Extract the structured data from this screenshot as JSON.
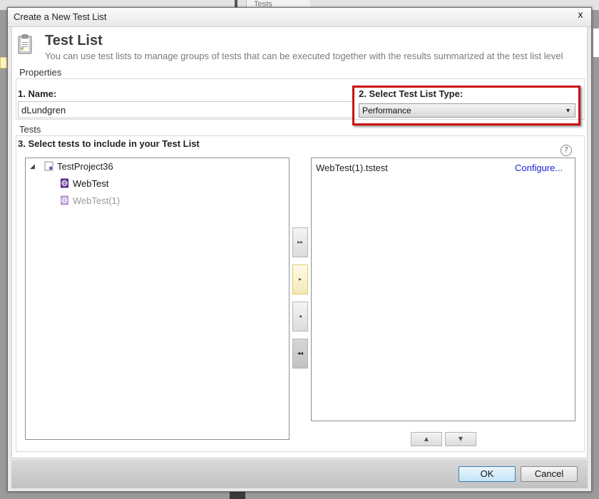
{
  "background": {
    "tab_label": "Tests"
  },
  "dialog": {
    "title": "Create a New Test List",
    "close_glyph": "x"
  },
  "header": {
    "icon": "clipboard-icon",
    "title": "Test List",
    "subtitle": "You can use test lists to manage groups of tests that can be executed together with the results summarized at the test list level"
  },
  "properties": {
    "group_label": "Properties",
    "name_label": "1. Name:",
    "name_value": "dLundgren",
    "type_label": "2. Select Test List Type:",
    "type_value": "Performance",
    "highlight_color": "#cc1010"
  },
  "tests": {
    "group_label": "Tests",
    "select_label": "3. Select tests to include in your Test List",
    "help_glyph": "?",
    "tree": {
      "project": "TestProject36",
      "items": [
        {
          "label": "WebTest",
          "enabled": true
        },
        {
          "label": "WebTest(1)",
          "enabled": false
        }
      ]
    },
    "selected": [
      {
        "label": "WebTest(1).tstest",
        "link": "Configure..."
      }
    ],
    "move_buttons": {
      "add_all": "▸▸",
      "add": "▸",
      "remove": "◂",
      "remove_all": "◂◂"
    },
    "order_buttons": {
      "up": "▲",
      "down": "▼"
    }
  },
  "footer": {
    "ok_label": "OK",
    "cancel_label": "Cancel"
  }
}
